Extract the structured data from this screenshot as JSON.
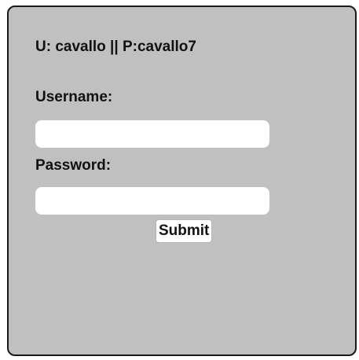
{
  "login": {
    "credentials_hint": "U: cavallo || P:cavallo7",
    "username_label": "Username:",
    "username_value": "",
    "password_label": "Password:",
    "password_value": "",
    "submit_label": "Submit"
  },
  "colors": {
    "panel_background": "#c0c0c0",
    "panel_border": "#1a1a1a",
    "field_background": "#ffffff",
    "text": "#111111"
  }
}
